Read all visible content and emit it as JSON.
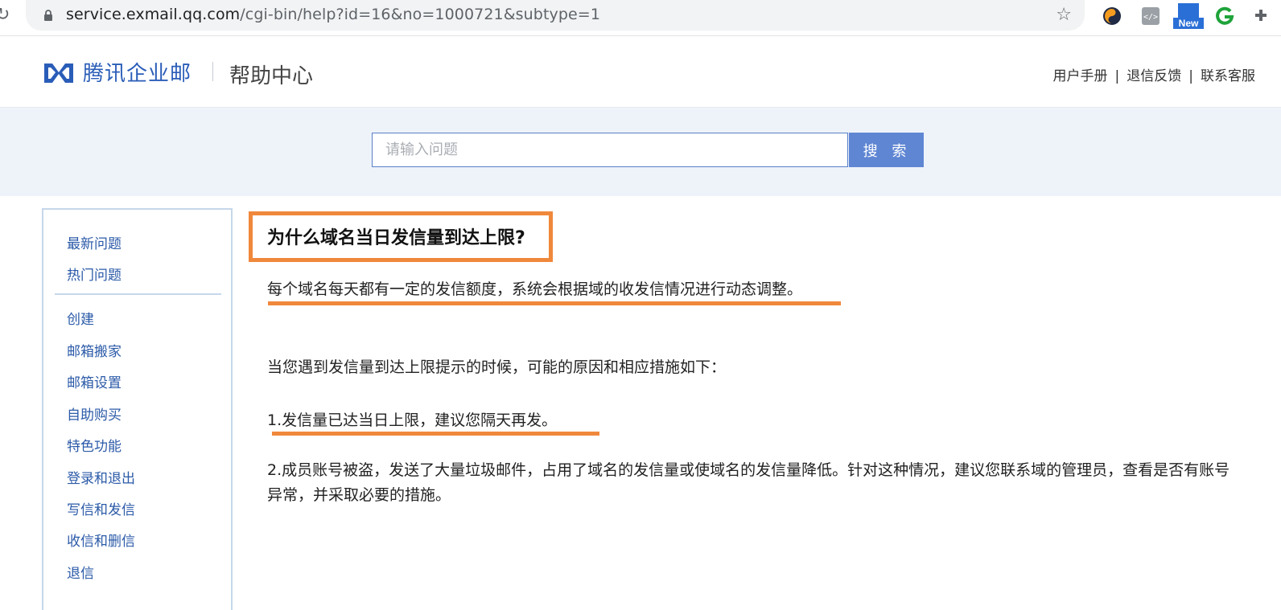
{
  "browser": {
    "url_host": "service.exmail.qq.com",
    "url_path": "/cgi-bin/help?id=16&no=1000721&subtype=1",
    "extension_new_badge": "New"
  },
  "header": {
    "brand": "腾讯企业邮",
    "section_title": "帮助中心",
    "links": [
      "用户手册",
      "退信反馈",
      "联系客服"
    ],
    "link_separator": "|"
  },
  "search": {
    "placeholder": "请输入问题",
    "button_label": "搜 索"
  },
  "sidebar": {
    "top_items": [
      "最新问题",
      "热门问题"
    ],
    "items": [
      "创建",
      "邮箱搬家",
      "邮箱设置",
      "自助购买",
      "特色功能",
      "登录和退出",
      "写信和发信",
      "收信和删信",
      "退信"
    ]
  },
  "article": {
    "title": "为什么域名当日发信量到达上限?",
    "intro": "每个域名每天都有一定的发信额度，系统会根据域的收发信情况进行动态调整。",
    "lead": "当您遇到发信量到达上限提示的时候，可能的原因和相应措施如下：",
    "reason_1": "1.发信量已达当日上限，建议您隔天再发。",
    "reason_2": "2.成员账号被盗，发送了大量垃圾邮件，占用了域名的发信量或使域名的发信量降低。针对这种情况，建议您联系域的管理员，查看是否有账号异常，并采取必要的措施。"
  },
  "colors": {
    "brand_blue": "#2a5db8",
    "search_button": "#5f86d3",
    "highlight_orange": "#f0883c",
    "link_blue": "#2b5aa8"
  }
}
